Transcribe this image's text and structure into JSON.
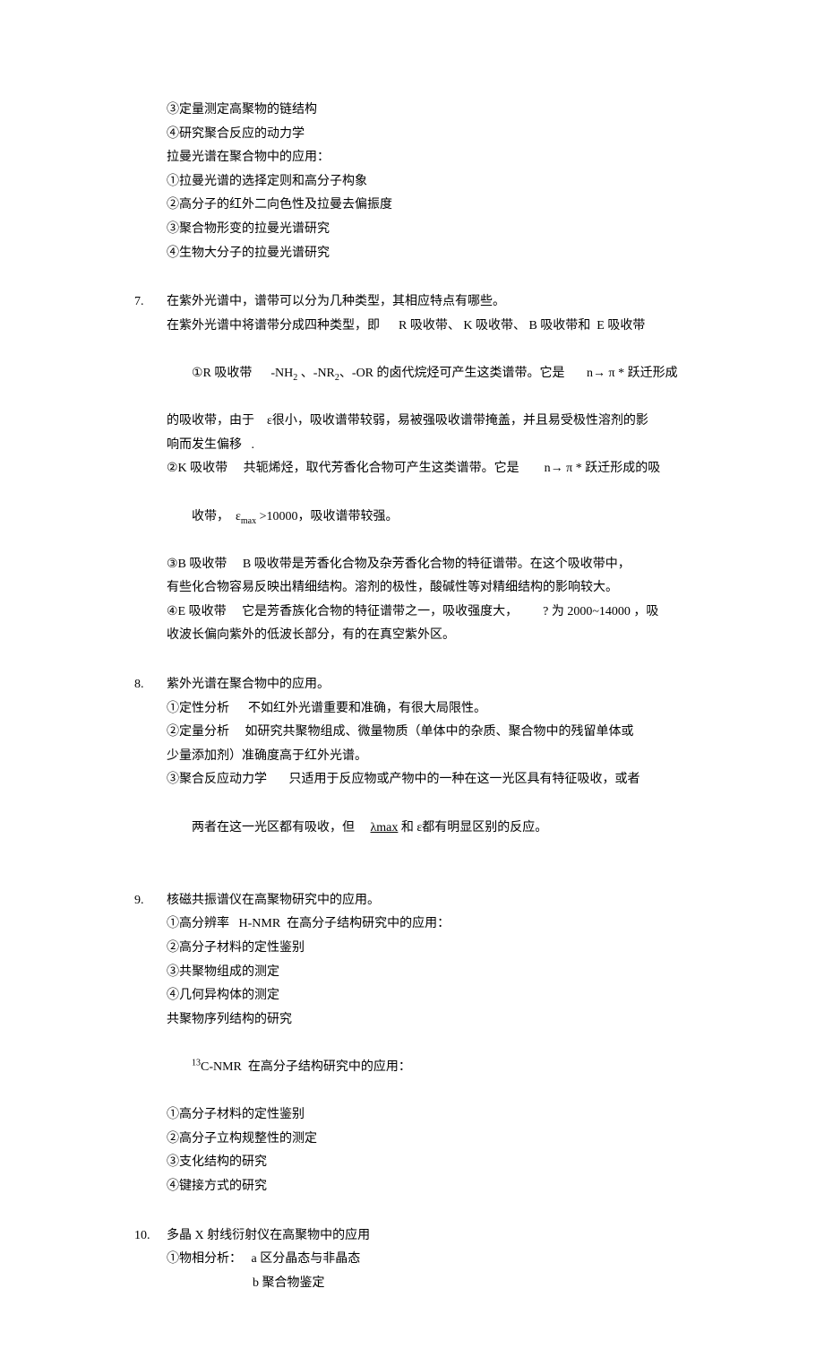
{
  "intro": {
    "lines": [
      "③定量测定高聚物的链结构",
      "④研究聚合反应的动力学",
      "拉曼光谱在聚合物中的应用：",
      "①拉曼光谱的选择定则和高分子构象",
      "②高分子的红外二向色性及拉曼去偏振度",
      "③聚合物形变的拉曼光谱研究",
      "④生物大分子的拉曼光谱研究"
    ]
  },
  "q7": {
    "num": "7.",
    "title": "在紫外光谱中，谱带可以分为几种类型，其相应特点有哪些。",
    "l1": "在紫外光谱中将谱带分成四种类型，即      R 吸收带、 K 吸收带、 B 吸收带和  E 吸收带",
    "l2a": "①R 吸收带      -NH",
    "l2b": " 、-NR",
    "l2c": "、-OR 的卤代烷烃可产生这类谱带。它是       n→ π * 跃迁形成",
    "l3": "的吸收带，由于    ε很小，吸收谱带较弱，易被强吸收谱带掩盖，并且易受极性溶剂的影",
    "l4": "响而发生偏移   .",
    "l5": "②K 吸收带     共轭烯烃，取代芳香化合物可产生这类谱带。它是        n→ π * 跃迁形成的吸",
    "l6a": "收带，  ε",
    "l6b": " >10000，吸收谱带较强。",
    "l7": "③B 吸收带     B 吸收带是芳香化合物及杂芳香化合物的特征谱带。在这个吸收带中，",
    "l8": "有些化合物容易反映出精细结构。溶剂的极性，酸碱性等对精细结构的影响较大。",
    "l9": "④E 吸收带     它是芳香族化合物的特征谱带之一，吸收强度大，        ? 为 2000~14000 ，吸",
    "l10": "收波长偏向紫外的低波长部分，有的在真空紫外区。",
    "sub2": "2",
    "submax": "max"
  },
  "q8": {
    "num": "8.",
    "title": "紫外光谱在聚合物中的应用。",
    "l1": "①定性分析      不如红外光谱重要和准确，有很大局限性。",
    "l2": "②定量分析     如研究共聚物组成、微量物质（单体中的杂质、聚合物中的残留单体或",
    "l3": "少量添加剂）准确度高于红外光谱。",
    "l4": "③聚合反应动力学       只适用于反应物或产物中的一种在这一光区具有特征吸收，或者",
    "l5a": "两者在这一光区都有吸收，但     ",
    "l5b": "λmax",
    "l5c": " 和 ε都有明显区别的反应。"
  },
  "q9": {
    "num": "9.",
    "title": "核磁共振谱仪在高聚物研究中的应用。",
    "l1": "①高分辨率   H-NMR  在高分子结构研究中的应用：",
    "l2": "②高分子材料的定性鉴别",
    "l3": "③共聚物组成的测定",
    "l4": "④几何异构体的测定",
    "l5": "共聚物序列结构的研究",
    "l6b": "C-NMR  在高分子结构研究中的应用：",
    "sup13": "13",
    "l7": "①高分子材料的定性鉴别",
    "l8": "②高分子立构规整性的测定",
    "l9": "③支化结构的研究",
    "l10": "④键接方式的研究"
  },
  "q10": {
    "num": "10.",
    "title": "多晶 X 射线衍射仪在高聚物中的应用",
    "l1": "①物相分析：   a 区分晶态与非晶态",
    "l2": "b 聚合物鉴定"
  }
}
